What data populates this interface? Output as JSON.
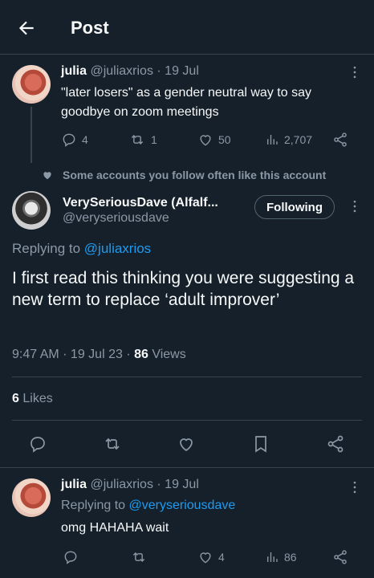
{
  "header": {
    "title": "Post"
  },
  "parent_tweet": {
    "author_name": "julia",
    "author_handle": "@juliaxrios",
    "time": "· 19 Jul",
    "text": "\"later losers\" as a gender neutral way to say goodbye on zoom meetings",
    "replies": "4",
    "reposts": "1",
    "likes": "50",
    "views": "2,707"
  },
  "social_context": "Some accounts you follow often like this account",
  "main_tweet": {
    "author_name": "VerySeriousDave (Alfalf...",
    "author_handle": "@veryseriousdave",
    "follow_label": "Following",
    "replying_prefix": "Replying to",
    "replying_handle": "@juliaxrios",
    "text": "I first read this thinking you were suggesting a new term to replace ‘adult improver’",
    "timestamp": "9:47 AM · 19 Jul 23 ·",
    "views_count": "86",
    "views_label": "Views",
    "likes_count": "6",
    "likes_label": "Likes"
  },
  "reply_tweet": {
    "author_name": "julia",
    "author_handle": "@juliaxrios",
    "time": "· 19 Jul",
    "replying_prefix": "Replying to",
    "replying_handle": "@veryseriousdave",
    "text": "omg HAHAHA wait",
    "likes": "4",
    "views": "86"
  },
  "colors": {
    "background": "#15202b",
    "text": "#f7f9f9",
    "muted": "#8b98a5",
    "link": "#1d9bf0",
    "divider": "#38444d"
  },
  "icons": [
    "back-arrow-icon",
    "more-icon",
    "reply-icon",
    "repost-icon",
    "like-icon",
    "views-icon",
    "share-icon",
    "bookmark-icon",
    "heart-small-icon"
  ]
}
